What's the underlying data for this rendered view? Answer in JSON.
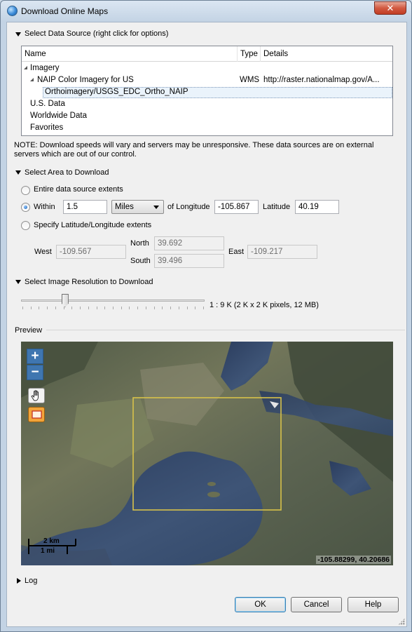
{
  "window": {
    "title": "Download Online Maps",
    "close_glyph": "✕"
  },
  "data_source": {
    "header": "Select Data Source (right click for options)",
    "columns": [
      "Name",
      "Type",
      "Details"
    ],
    "rows": {
      "imagery": "Imagery",
      "naip": {
        "name": "NAIP Color Imagery for US",
        "type": "WMS",
        "details": "http://raster.nationalmap.gov/A..."
      },
      "ortho": "Orthoimagery/USGS_EDC_Ortho_NAIP",
      "us_data": "U.S. Data",
      "worldwide": "Worldwide Data",
      "favorites": "Favorites"
    },
    "note": "NOTE: Download speeds will vary and servers may be unresponsive. These data sources are on external servers which are out of our control."
  },
  "area": {
    "header": "Select Area to Download",
    "entire_label": "Entire data source extents",
    "within_label": "Within",
    "within_value": "1.5",
    "units_selected": "Miles",
    "of_longitude_label": "of Longitude",
    "longitude_value": "-105.867",
    "latitude_label": "Latitude",
    "latitude_value": "40.19",
    "specify_label": "Specify Latitude/Longitude extents",
    "selected_option": "within",
    "extents": {
      "north_label": "North",
      "north_value": "39.692",
      "west_label": "West",
      "west_value": "-109.567",
      "east_label": "East",
      "east_value": "-109.217",
      "south_label": "South",
      "south_value": "39.496"
    }
  },
  "resolution": {
    "header": "Select Image Resolution to Download",
    "value_text": "1 : 9 K (2 K x 2 K pixels, 12 MB)",
    "slider_position": 0.24
  },
  "preview": {
    "label": "Preview",
    "zoom_in": "+",
    "zoom_out": "−",
    "pan_icon": "hand-icon",
    "select_icon": "rectangle-select-icon",
    "scale_km": "2 km",
    "scale_mi": "1 mi",
    "coordinates": "-105.88299, 40.20686"
  },
  "log": {
    "label": "Log"
  },
  "buttons": {
    "ok": "OK",
    "cancel": "Cancel",
    "help": "Help"
  }
}
